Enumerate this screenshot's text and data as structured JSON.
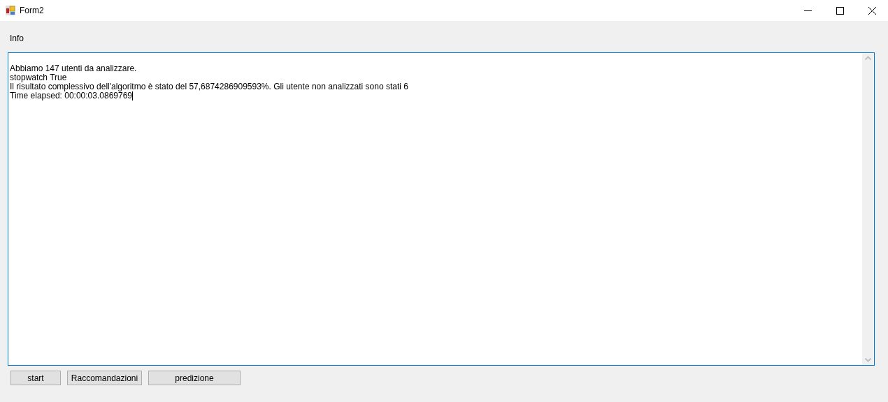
{
  "window": {
    "title": "Form2"
  },
  "label": "Info",
  "output_lines": [
    "Abbiamo 147 utenti da analizzare.",
    "stopwatch True",
    "Il risultato complessivo dell'algoritmo è stato del 57,6874286909593%. Gli utente non analizzati sono stati 6",
    "Time elapsed: 00:00:03.0869769"
  ],
  "buttons": [
    "start",
    "Raccomandazioni",
    "predizione"
  ]
}
